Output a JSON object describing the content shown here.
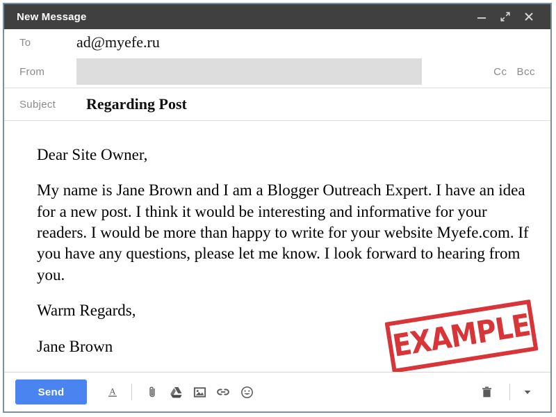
{
  "window": {
    "title": "New Message",
    "controls": [
      {
        "name": "minimize",
        "label": "–"
      },
      {
        "name": "expand",
        "label": "⤢"
      },
      {
        "name": "close",
        "label": "×"
      }
    ],
    "title_bar_color": "#404040",
    "border_color": "#7a90a8"
  },
  "fields": {
    "to_label": "To",
    "to_value": "ad@myefe.ru",
    "from_label": "From",
    "from_value": "",
    "cc_label": "Cc",
    "bcc_label": "Bcc",
    "subject_label": "Subject",
    "subject_value": "Regarding Post"
  },
  "body": {
    "greeting": "Dear Site Owner,",
    "paragraph": "My name is Jane Brown and I am a Blogger Outreach Expert. I have an idea for a new post. I think it would be interesting and informative for your readers. I would be more than happy to write for your website Myefe.com. If you have any questions, please let me know. I look forward to hearing from you.",
    "closing": "Warm Regards,",
    "signature": "Jane Brown"
  },
  "stamp": {
    "text": "EXAMPLE",
    "color": "#d5262a"
  },
  "toolbar": {
    "send_label": "Send",
    "send_color": "#4a84f0",
    "icons": [
      {
        "name": "format-icon",
        "title": "Formatting options"
      },
      {
        "name": "attach-icon",
        "title": "Attach files"
      },
      {
        "name": "drive-icon",
        "title": "Insert files using Drive"
      },
      {
        "name": "photo-icon",
        "title": "Insert photo"
      },
      {
        "name": "link-icon",
        "title": "Insert link"
      },
      {
        "name": "emoji-icon",
        "title": "Insert emoji"
      },
      {
        "name": "trash-icon",
        "title": "Discard draft"
      },
      {
        "name": "more-options-icon",
        "title": "More options"
      }
    ]
  }
}
